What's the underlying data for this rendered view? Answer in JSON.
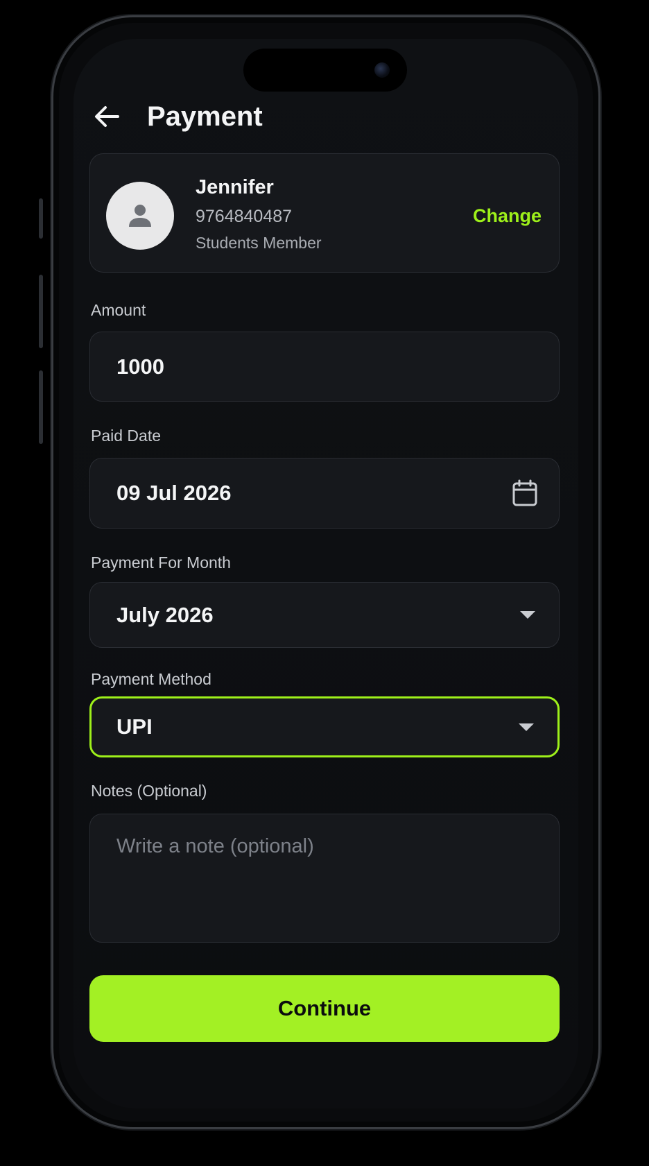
{
  "header": {
    "title": "Payment",
    "back_icon": "arrow-left-icon"
  },
  "member": {
    "avatar_icon": "person-icon",
    "name": "Jennifer",
    "phone": "9764840487",
    "type": "Students Member",
    "change_label": "Change"
  },
  "form": {
    "amount": {
      "label": "Amount",
      "value": "1000"
    },
    "paid_date": {
      "label": "Paid Date",
      "value": "09 Jul 2026",
      "icon": "calendar-icon"
    },
    "payment_month": {
      "label": "Payment For Month",
      "value": "July 2026",
      "icon": "caret-down-icon"
    },
    "payment_method": {
      "label": "Payment Method",
      "value": "UPI",
      "icon": "caret-down-icon",
      "focused": true
    },
    "notes": {
      "label": "Notes (Optional)",
      "placeholder": "Write a note (optional)",
      "value": ""
    }
  },
  "actions": {
    "continue_label": "Continue"
  },
  "colors": {
    "accent": "#9ef01a",
    "button": "#a3f024",
    "background": "#0d0f12",
    "card": "#16181c"
  }
}
